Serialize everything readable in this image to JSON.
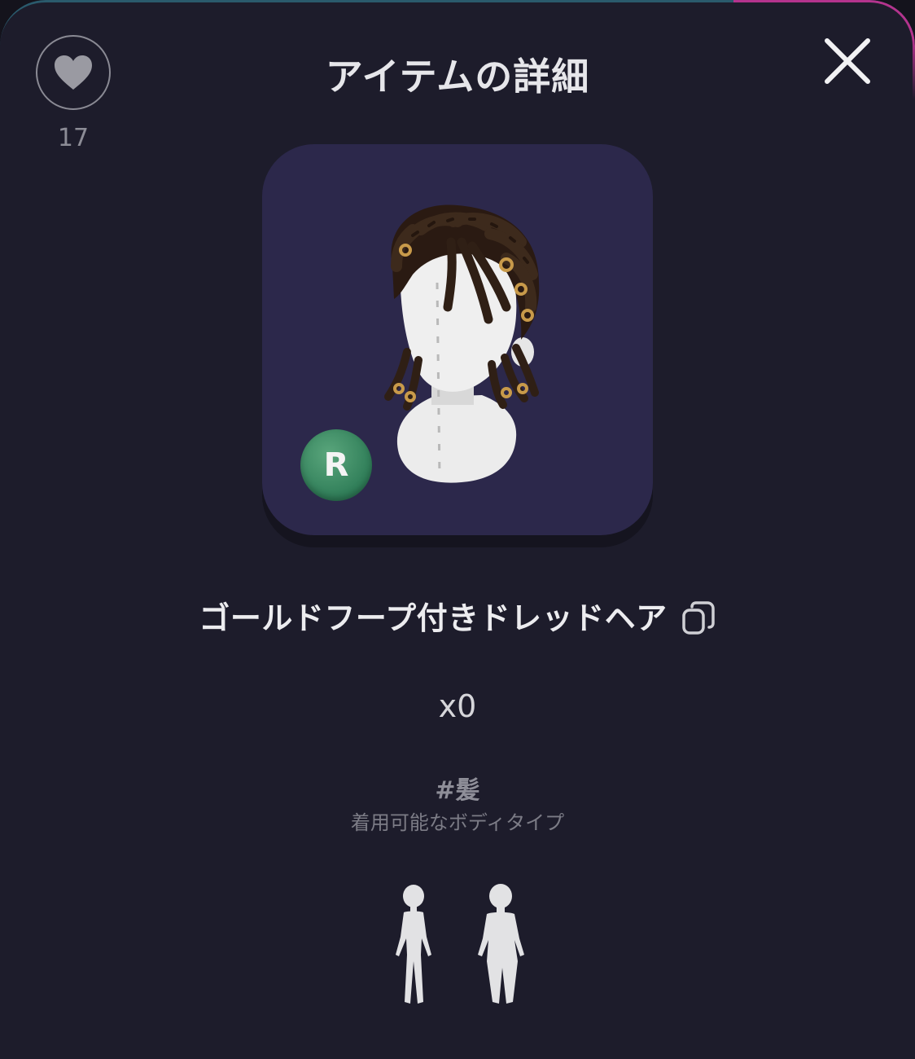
{
  "header": {
    "title": "アイテムの詳細",
    "favorite_count": "17",
    "icons": {
      "favorite": "heart-icon",
      "close": "close-icon"
    }
  },
  "item": {
    "name": "ゴールドフープ付きドレッドヘア",
    "rarity": "R",
    "rarity_color": "#2f7d58",
    "quantity": "x0",
    "tag": "#髪",
    "body_type_label": "着用可能なボディタイプ",
    "body_types": [
      "slim-body-type-icon",
      "curvy-body-type-icon"
    ],
    "copy_icon": "copy-icon"
  },
  "colors": {
    "background": "#1d1c2b",
    "card": "#2c284b",
    "text_primary": "#ececef",
    "text_muted": "#8e8e98"
  }
}
